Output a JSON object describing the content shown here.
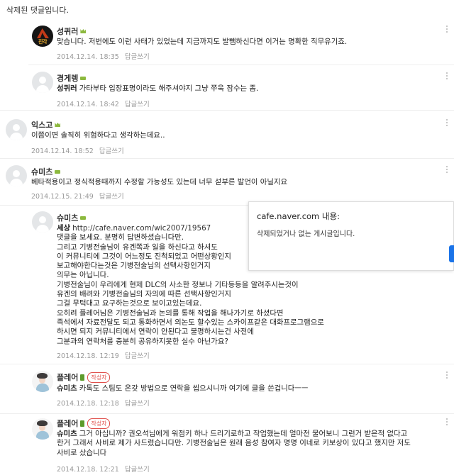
{
  "deleted_notice": "삭제된 댓글입니다.",
  "popup": {
    "title": "cafe.naver.com 내용:",
    "message": "삭제되었거나 없는 게시글입니다."
  },
  "reply_label": "답글쓰기",
  "author_badge": "작성자",
  "comments": [
    {
      "nickname": "성퀴러",
      "avatar_text": "진각",
      "text": "맞습니다. 저번에도 이런 사태가 있었는데 지금까지도 발뺌하신다면 이거는 명확한 직무유기죠.",
      "date": "2014.12.14. 18:35"
    },
    {
      "nickname": "경게렝",
      "mention": "성퀴러",
      "text": "가타부타 입장표명이라도 해주셔야지 그냥 쭈욱 잠수는 좀.",
      "date": "2014.12.14. 18:42"
    },
    {
      "nickname": "익스고",
      "text": "이쯤이면 솔직히 위험하다고 생각하는데요..",
      "date": "2014.12.14. 18:52"
    },
    {
      "nickname": "슈미츠",
      "text": "베타적용이고 정식적용때까지 수정할 가능성도 있는데 너무 섣부른 발언이 아닐지요",
      "date": "2014.12.15. 21:49"
    },
    {
      "nickname": "슈미츠",
      "mention": "세상",
      "link": "http://cafe.naver.com/wic2007/19567",
      "lines": [
        "댓글을 보세요. 분명히 답변하셨습니다만.",
        "그리고 기병전술님이 유겐쪽과 일을 하신다고 하셔도",
        "이 커뮤니티에 그것이 어느정도 진척되었고 어떤상황인지",
        "보고해야한다는것은 기병전술님의 선택사항인거지",
        "의무는 아닙니다.",
        "기병전술님이 우리에게 현제 DLC의 사소한 정보나 기타등등을 알려주시는것이",
        "유겐의 배려와 기병전술님의 자의에 따른 선택사항인거지",
        "그걸 무턱대고 요구하는것으로 보이고있는데요.",
        "오히려 플레어님은 기병전술님과 논의를 통해 작업을 해나가기로 하셨다면",
        "즉석에서 자료전달도 되고 통화하면서 의논도 할수있는 스카이프같은 대화프로그램으로",
        "하시면 되지 커뮤니티에서 연락이 안된다고 불평하시는건 사전에",
        "그분과의 연락처를 충분히 공유하지못한 실수 아닌가요?"
      ],
      "date": "2014.12.18. 12:19"
    },
    {
      "nickname": "플레어",
      "mention": "슈미츠",
      "text": "카톡도 스팀도 온갖 방법으로 연락을 씹으시니까 여기에 글을 쓴겁니다ㅡㅡ",
      "date": "2014.12.18. 12:18"
    },
    {
      "nickname": "플레어",
      "mention": "슈미츠",
      "lines": [
        "그거 아십니까? 권오석님에게 워점키 하나 드리기로하고 작업했는데 얼마전 물어보니 그런거 받은적 없다고",
        "한거 그래서 사비로 제가 사드렸습니다만. 기병전술님은 원래 음성 참여자 명명 이네로 키보상이 있다고 했지만 저도",
        "사비로 샀습니다"
      ],
      "date": "2014.12.18. 12:21"
    }
  ]
}
